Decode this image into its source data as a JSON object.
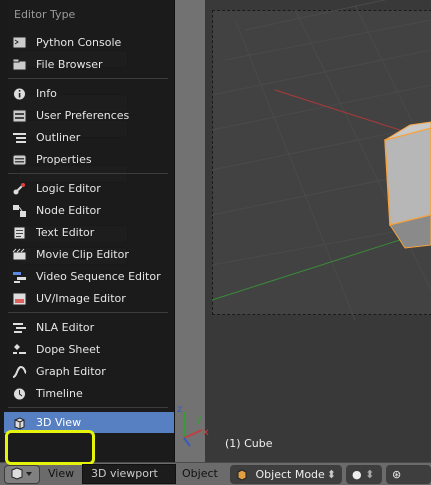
{
  "menu": {
    "title": "Editor Type",
    "groups": [
      [
        {
          "label": "Python Console",
          "icon": "console-icon"
        },
        {
          "label": "File Browser",
          "icon": "file-browser-icon"
        }
      ],
      [
        {
          "label": "Info",
          "icon": "info-icon"
        },
        {
          "label": "User Preferences",
          "icon": "preferences-icon"
        },
        {
          "label": "Outliner",
          "icon": "outliner-icon"
        },
        {
          "label": "Properties",
          "icon": "properties-icon"
        }
      ],
      [
        {
          "label": "Logic Editor",
          "icon": "logic-icon"
        },
        {
          "label": "Node Editor",
          "icon": "node-icon"
        },
        {
          "label": "Text Editor",
          "icon": "text-icon"
        },
        {
          "label": "Movie Clip Editor",
          "icon": "clip-icon"
        },
        {
          "label": "Video Sequence Editor",
          "icon": "sequence-icon"
        },
        {
          "label": "UV/Image Editor",
          "icon": "image-icon"
        }
      ],
      [
        {
          "label": "NLA Editor",
          "icon": "nla-icon"
        },
        {
          "label": "Dope Sheet",
          "icon": "dopesheet-icon"
        },
        {
          "label": "Graph Editor",
          "icon": "graph-icon"
        },
        {
          "label": "Timeline",
          "icon": "timeline-icon"
        }
      ],
      [
        {
          "label": "3D View",
          "icon": "view3d-icon",
          "active": true
        }
      ]
    ]
  },
  "viewport": {
    "object_info": "(1) Cube"
  },
  "header": {
    "view_label": "View",
    "tooltip": "3D viewport",
    "object_label": "Object",
    "mode_label": "Object Mode"
  },
  "colors": {
    "accent": "#5680c2",
    "highlight_box": "#e5f40a",
    "cube_outline": "#f7a23c",
    "axis_x": "#c04040",
    "axis_y": "#40a040"
  }
}
